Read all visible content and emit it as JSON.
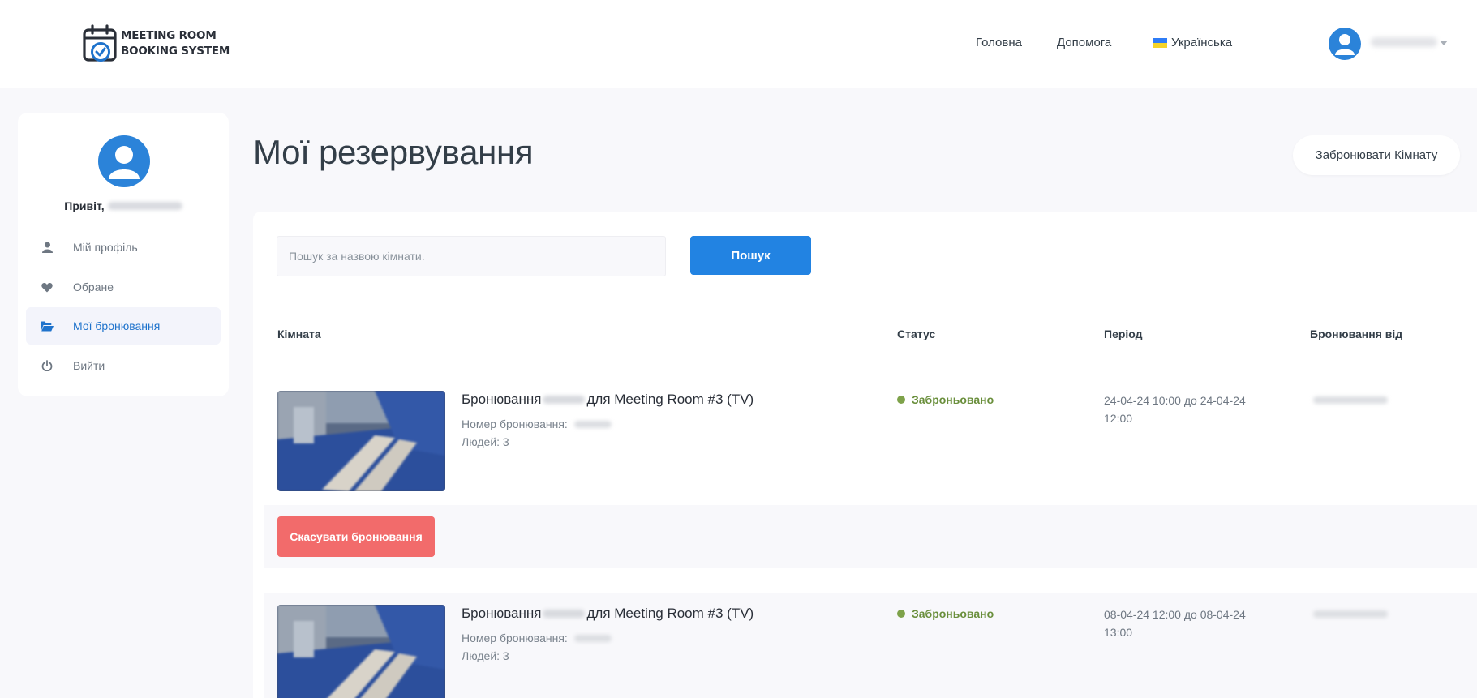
{
  "header": {
    "logo_line1": "MEETING ROOM",
    "logo_line2": "BOOKING SYSTEM",
    "nav": [
      {
        "label": "Головна"
      },
      {
        "label": "Допомога"
      },
      {
        "label": "Українська"
      }
    ],
    "user_icon": "user-avatar-icon"
  },
  "sidebar": {
    "greeting": "Привіт,",
    "items": [
      {
        "label": "Мій профіль",
        "icon": "user-icon"
      },
      {
        "label": "Обране",
        "icon": "heart-icon"
      },
      {
        "label": "Мої бронювання",
        "icon": "folder-open-icon",
        "active": true
      },
      {
        "label": "Вийти",
        "icon": "power-icon"
      }
    ]
  },
  "main": {
    "title": "Мої резервування",
    "book_room_label": "Забронювати Кімнату",
    "search": {
      "placeholder": "Пошук за назвою кімнати.",
      "button_label": "Пошук"
    },
    "columns": [
      "Кімната",
      "Статус",
      "Період",
      "Бронювання від"
    ],
    "bookings": [
      {
        "title_prefix": "Бронювання",
        "title_suffix": "для Meeting Room #3 (TV)",
        "number_label": "Номер бронювання:",
        "people": "Людей: 3",
        "status": "Заброньовано",
        "period": "24-04-24 10:00 до 24-04-24 12:00",
        "cancel_label": "Скасувати бронювання"
      },
      {
        "title_prefix": "Бронювання",
        "title_suffix": "для Meeting Room #3 (TV)",
        "number_label": "Номер бронювання:",
        "people": "Людей: 3",
        "status": "Заброньовано",
        "period": "08-04-24 12:00 до 08-04-24 13:00"
      }
    ]
  },
  "colors": {
    "accent": "#2283e2",
    "status_green": "#7ea24a",
    "danger": "#f26b6b",
    "background": "#f8f8fb"
  }
}
